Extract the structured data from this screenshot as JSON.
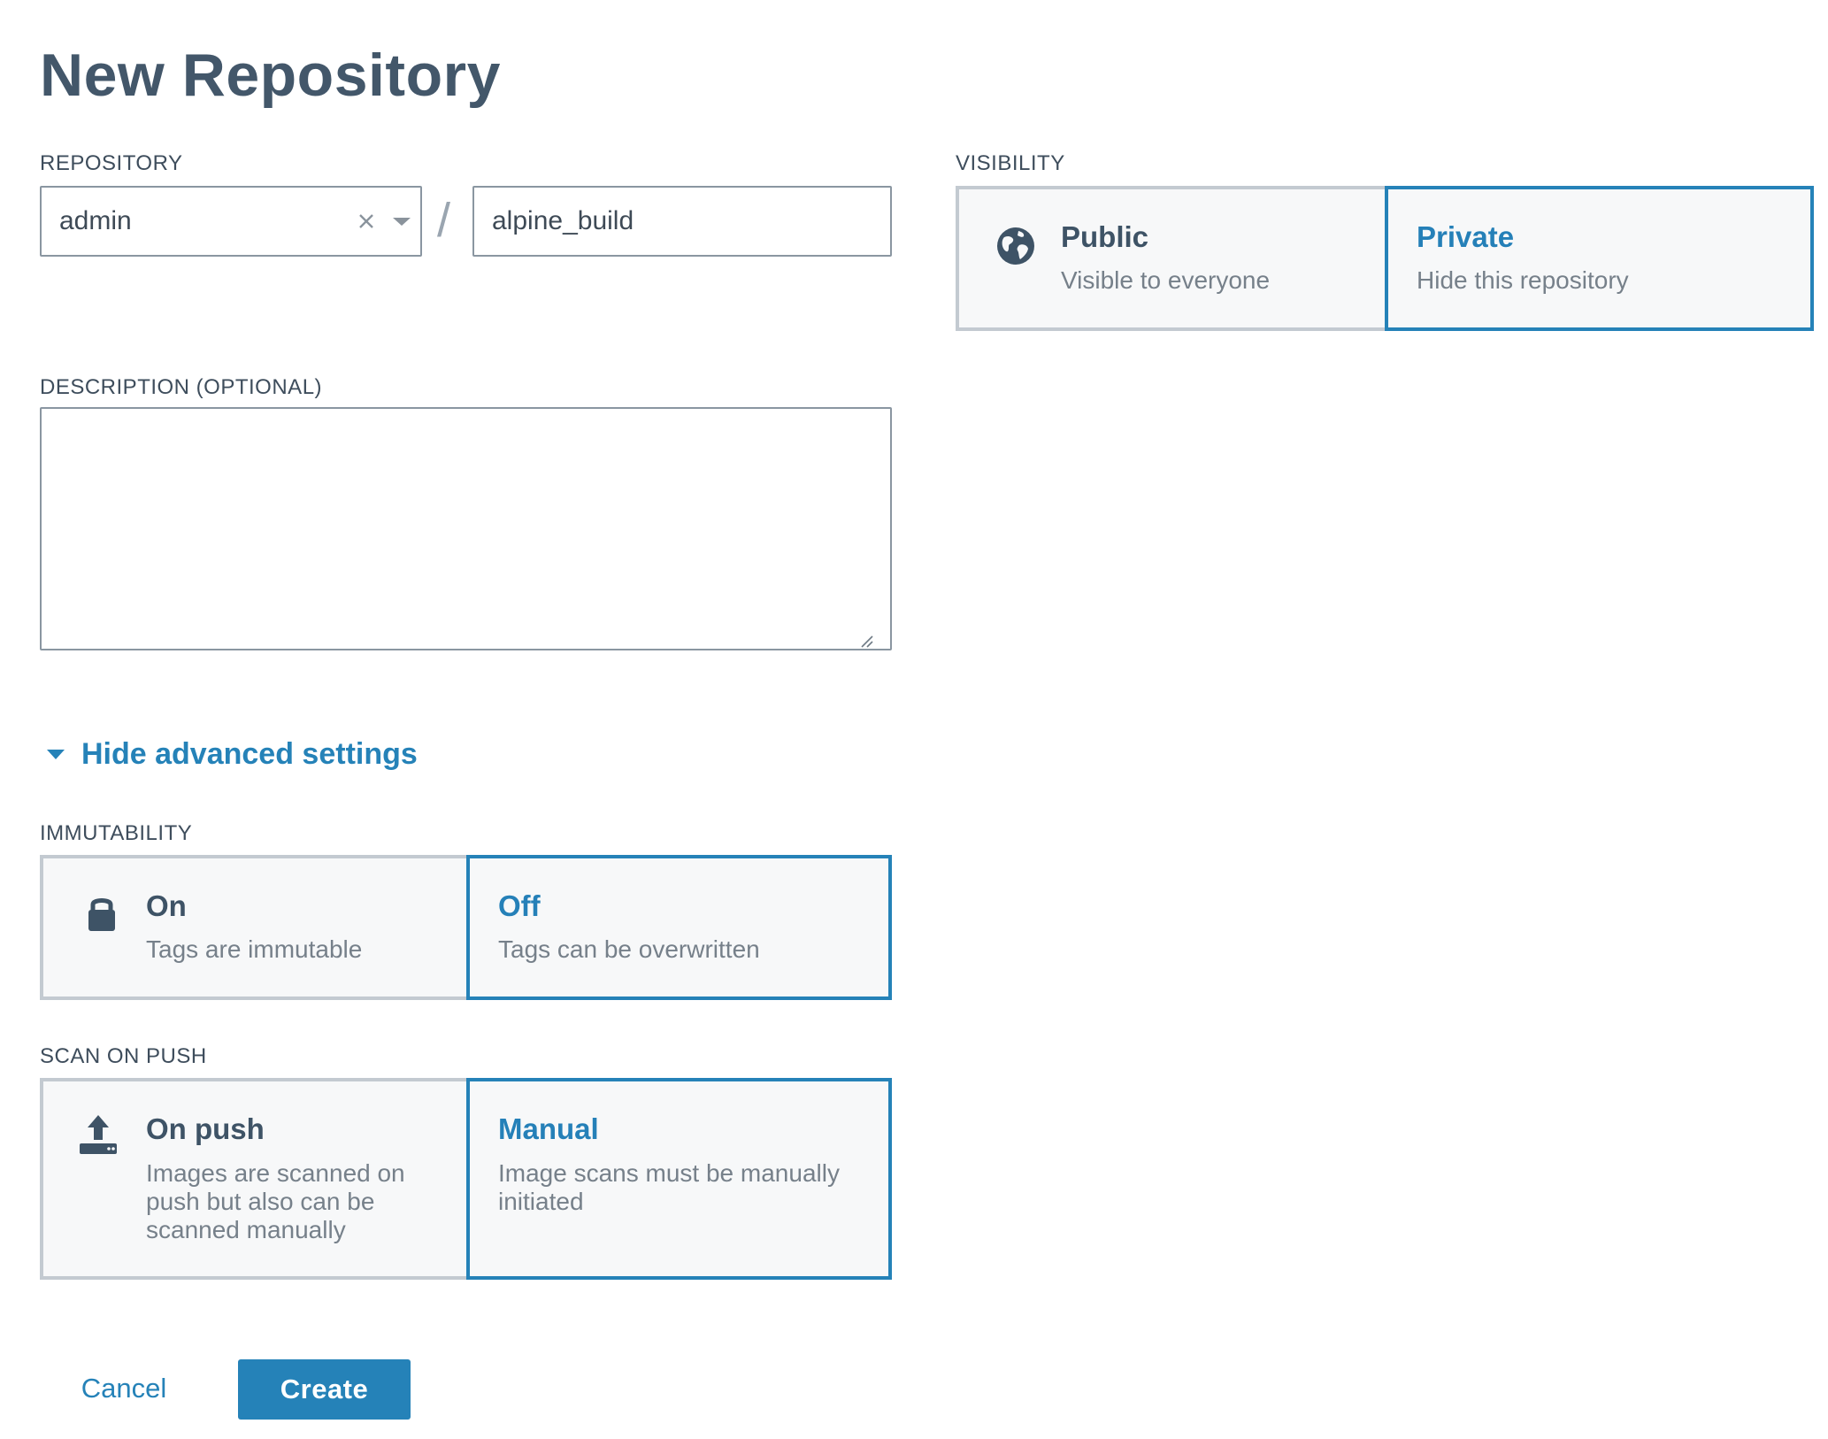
{
  "page": {
    "title": "New Repository"
  },
  "repository": {
    "label": "REPOSITORY",
    "namespace_value": "admin",
    "separator": "/",
    "name_value": "alpine_build"
  },
  "visibility": {
    "label": "VISIBILITY",
    "options": [
      {
        "title": "Public",
        "description": "Visible to everyone",
        "icon": "globe-icon",
        "selected": false
      },
      {
        "title": "Private",
        "description": "Hide this repository",
        "icon": "",
        "selected": true
      }
    ]
  },
  "description": {
    "label": "DESCRIPTION  (OPTIONAL)",
    "value": ""
  },
  "advanced": {
    "toggle_label": "Hide advanced settings"
  },
  "immutability": {
    "label": "IMMUTABILITY",
    "options": [
      {
        "title": "On",
        "description": "Tags are immutable",
        "icon": "lock-icon",
        "selected": false
      },
      {
        "title": "Off",
        "description": "Tags can be overwritten",
        "icon": "",
        "selected": true
      }
    ]
  },
  "scan_on_push": {
    "label": "SCAN ON PUSH",
    "options": [
      {
        "title": "On push",
        "description": "Images are scanned on push but also can be scanned manually",
        "icon": "upload-icon",
        "selected": false
      },
      {
        "title": "Manual",
        "description": "Image scans must be manually initiated",
        "icon": "",
        "selected": true
      }
    ]
  },
  "actions": {
    "cancel_label": "Cancel",
    "create_label": "Create"
  },
  "colors": {
    "accent": "#2582b8",
    "text_dark": "#3e5366",
    "text_muted": "#76808a",
    "border": "#c3cad1"
  }
}
